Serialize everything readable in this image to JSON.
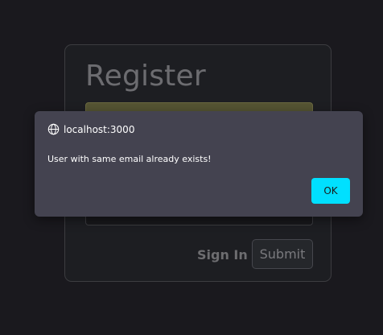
{
  "register_form": {
    "title": "Register",
    "sign_in_label": "Sign In",
    "submit_label": "Submit"
  },
  "alert": {
    "origin": "localhost:3000",
    "origin_icon": "globe-icon",
    "message": "User with same email already exists!",
    "ok_label": "OK"
  },
  "colors": {
    "background": "#1a191e",
    "dialog_background": "#444350",
    "ok_button": "#00e0ff",
    "autofill_field": "#555433"
  }
}
